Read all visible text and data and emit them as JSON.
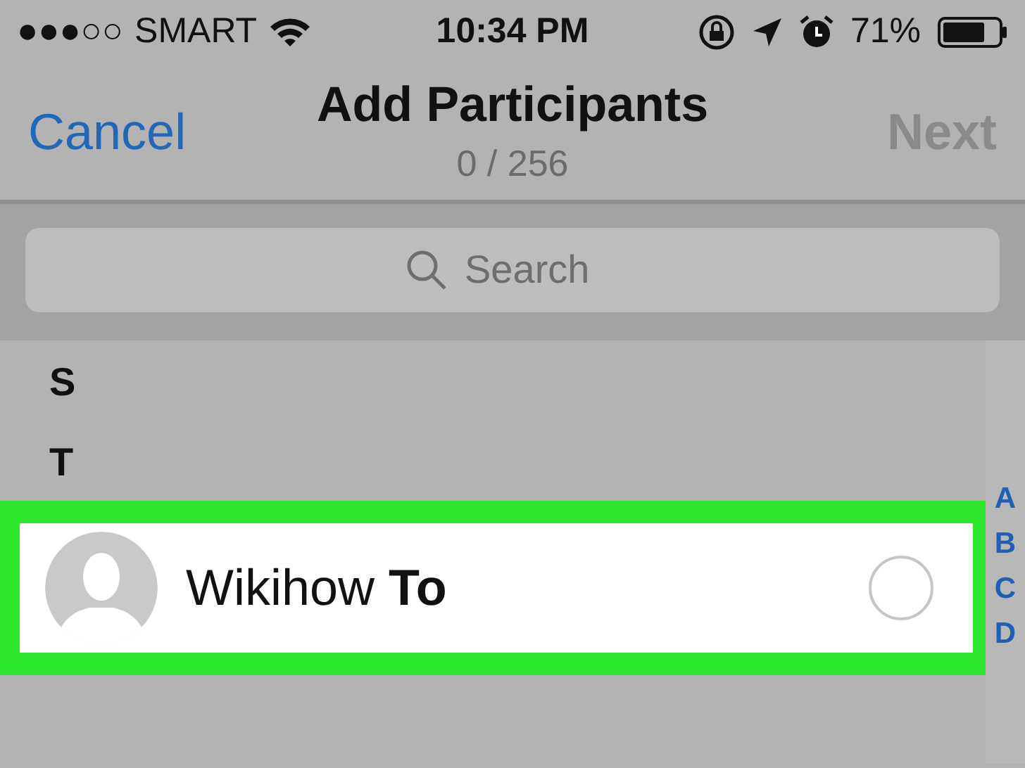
{
  "status_bar": {
    "signal": "●●●○○",
    "carrier": "SMART",
    "time": "10:34 PM",
    "battery_percent": "71%"
  },
  "nav": {
    "cancel": "Cancel",
    "title": "Add Participants",
    "subtitle": "0 / 256",
    "next": {
      "label": "Next",
      "disabled": true
    }
  },
  "search": {
    "placeholder": "Search"
  },
  "sections": [
    {
      "header": "S"
    },
    {
      "header": "T",
      "contacts": [
        {
          "name": "Wikihow **To**",
          "selected": false,
          "highlighted": true
        }
      ]
    }
  ],
  "index_letters": [
    "A",
    "B",
    "C",
    "D"
  ]
}
